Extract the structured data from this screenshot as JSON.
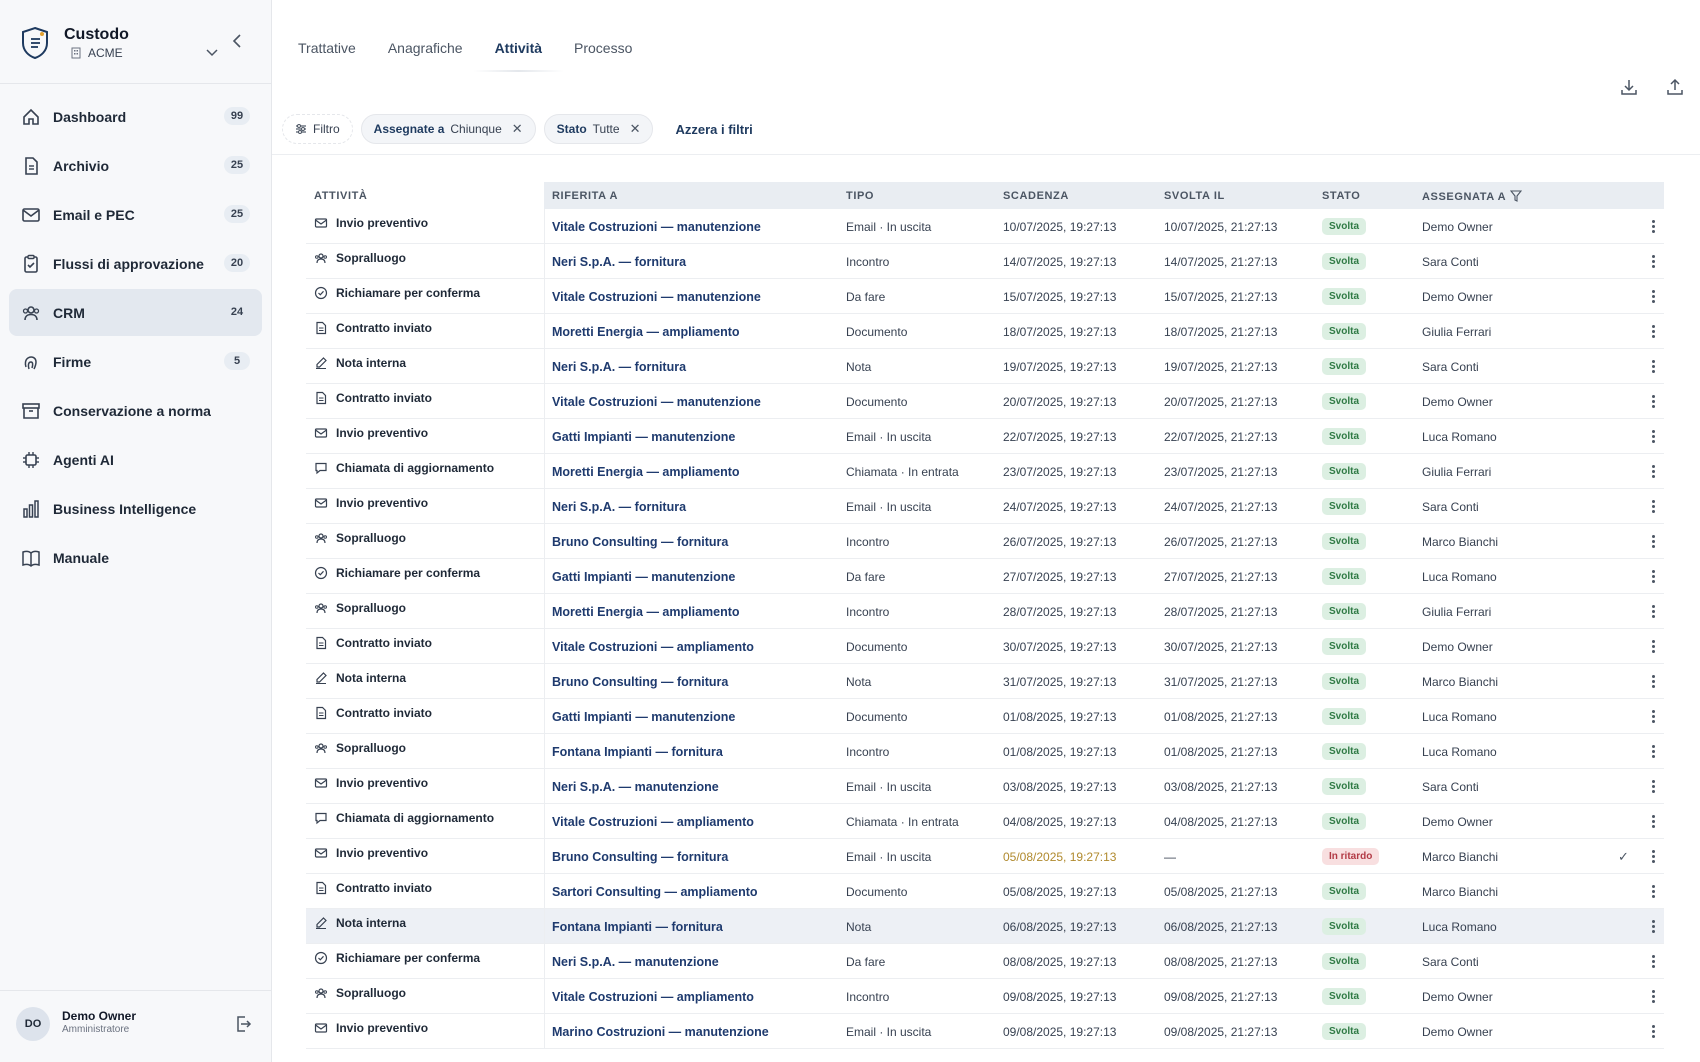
{
  "brand": {
    "name": "Custodo",
    "org": "ACME"
  },
  "nav": [
    {
      "label": "Dashboard",
      "badge": "99",
      "icon": "home-icon"
    },
    {
      "label": "Archivio",
      "badge": "25",
      "icon": "document-icon"
    },
    {
      "label": "Email e PEC",
      "badge": "25",
      "icon": "mail-icon"
    },
    {
      "label": "Flussi di approvazione",
      "badge": "20",
      "icon": "clipboard-check-icon"
    },
    {
      "label": "CRM",
      "badge": "24",
      "icon": "users-icon",
      "active": true
    },
    {
      "label": "Firme",
      "badge": "5",
      "icon": "fingerprint-icon"
    },
    {
      "label": "Conservazione a norma",
      "badge": "",
      "icon": "archive-box-icon"
    },
    {
      "label": "Agenti AI",
      "badge": "",
      "icon": "chip-icon"
    },
    {
      "label": "Business Intelligence",
      "badge": "",
      "icon": "bar-chart-icon"
    },
    {
      "label": "Manuale",
      "badge": "",
      "icon": "book-icon"
    }
  ],
  "user": {
    "initials": "DO",
    "name": "Demo Owner",
    "role": "Amministratore"
  },
  "tabs": [
    {
      "label": "Trattative",
      "active": false
    },
    {
      "label": "Anagrafiche",
      "active": false
    },
    {
      "label": "Attività",
      "active": true
    },
    {
      "label": "Processo",
      "active": false
    }
  ],
  "filters": {
    "filter_label": "Filtro",
    "chips": [
      {
        "key": "Assegnate a",
        "value": "Chiunque"
      },
      {
        "key": "Stato",
        "value": "Tutte"
      }
    ],
    "reset_label": "Azzera i filtri"
  },
  "table": {
    "headers": [
      "ATTIVITÀ",
      "RIFERITA A",
      "TIPO",
      "SCADENZA",
      "SVOLTA IL",
      "STATO",
      "ASSEGNATA A"
    ],
    "rows": [
      {
        "icon": "mail-icon",
        "attivita": "Invio preventivo",
        "riferita": "Vitale Costruzioni — manutenzione",
        "tipo": "Email · In uscita",
        "scadenza": "10/07/2025, 19:27:13",
        "svolta": "10/07/2025, 21:27:13",
        "stato": "Svolta",
        "assegnata": "Demo Owner"
      },
      {
        "icon": "people-icon",
        "attivita": "Sopralluogo",
        "riferita": "Neri S.p.A. — fornitura",
        "tipo": "Incontro",
        "scadenza": "14/07/2025, 19:27:13",
        "svolta": "14/07/2025, 21:27:13",
        "stato": "Svolta",
        "assegnata": "Sara Conti"
      },
      {
        "icon": "check-circle-icon",
        "attivita": "Richiamare per conferma",
        "riferita": "Vitale Costruzioni — manutenzione",
        "tipo": "Da fare",
        "scadenza": "15/07/2025, 19:27:13",
        "svolta": "15/07/2025, 21:27:13",
        "stato": "Svolta",
        "assegnata": "Demo Owner"
      },
      {
        "icon": "file-icon",
        "attivita": "Contratto inviato",
        "riferita": "Moretti Energia — ampliamento",
        "tipo": "Documento",
        "scadenza": "18/07/2025, 19:27:13",
        "svolta": "18/07/2025, 21:27:13",
        "stato": "Svolta",
        "assegnata": "Giulia Ferrari"
      },
      {
        "icon": "edit-icon",
        "attivita": "Nota interna",
        "riferita": "Neri S.p.A. — fornitura",
        "tipo": "Nota",
        "scadenza": "19/07/2025, 19:27:13",
        "svolta": "19/07/2025, 21:27:13",
        "stato": "Svolta",
        "assegnata": "Sara Conti"
      },
      {
        "icon": "file-icon",
        "attivita": "Contratto inviato",
        "riferita": "Vitale Costruzioni — manutenzione",
        "tipo": "Documento",
        "scadenza": "20/07/2025, 19:27:13",
        "svolta": "20/07/2025, 21:27:13",
        "stato": "Svolta",
        "assegnata": "Demo Owner"
      },
      {
        "icon": "mail-icon",
        "attivita": "Invio preventivo",
        "riferita": "Gatti Impianti — manutenzione",
        "tipo": "Email · In uscita",
        "scadenza": "22/07/2025, 19:27:13",
        "svolta": "22/07/2025, 21:27:13",
        "stato": "Svolta",
        "assegnata": "Luca Romano"
      },
      {
        "icon": "chat-icon",
        "attivita": "Chiamata di aggiornamento",
        "riferita": "Moretti Energia — ampliamento",
        "tipo": "Chiamata · In entrata",
        "scadenza": "23/07/2025, 19:27:13",
        "svolta": "23/07/2025, 21:27:13",
        "stato": "Svolta",
        "assegnata": "Giulia Ferrari"
      },
      {
        "icon": "mail-icon",
        "attivita": "Invio preventivo",
        "riferita": "Neri S.p.A. — fornitura",
        "tipo": "Email · In uscita",
        "scadenza": "24/07/2025, 19:27:13",
        "svolta": "24/07/2025, 21:27:13",
        "stato": "Svolta",
        "assegnata": "Sara Conti"
      },
      {
        "icon": "people-icon",
        "attivita": "Sopralluogo",
        "riferita": "Bruno Consulting — fornitura",
        "tipo": "Incontro",
        "scadenza": "26/07/2025, 19:27:13",
        "svolta": "26/07/2025, 21:27:13",
        "stato": "Svolta",
        "assegnata": "Marco Bianchi"
      },
      {
        "icon": "check-circle-icon",
        "attivita": "Richiamare per conferma",
        "riferita": "Gatti Impianti — manutenzione",
        "tipo": "Da fare",
        "scadenza": "27/07/2025, 19:27:13",
        "svolta": "27/07/2025, 21:27:13",
        "stato": "Svolta",
        "assegnata": "Luca Romano"
      },
      {
        "icon": "people-icon",
        "attivita": "Sopralluogo",
        "riferita": "Moretti Energia — ampliamento",
        "tipo": "Incontro",
        "scadenza": "28/07/2025, 19:27:13",
        "svolta": "28/07/2025, 21:27:13",
        "stato": "Svolta",
        "assegnata": "Giulia Ferrari"
      },
      {
        "icon": "file-icon",
        "attivita": "Contratto inviato",
        "riferita": "Vitale Costruzioni — ampliamento",
        "tipo": "Documento",
        "scadenza": "30/07/2025, 19:27:13",
        "svolta": "30/07/2025, 21:27:13",
        "stato": "Svolta",
        "assegnata": "Demo Owner"
      },
      {
        "icon": "edit-icon",
        "attivita": "Nota interna",
        "riferita": "Bruno Consulting — fornitura",
        "tipo": "Nota",
        "scadenza": "31/07/2025, 19:27:13",
        "svolta": "31/07/2025, 21:27:13",
        "stato": "Svolta",
        "assegnata": "Marco Bianchi"
      },
      {
        "icon": "file-icon",
        "attivita": "Contratto inviato",
        "riferita": "Gatti Impianti — manutenzione",
        "tipo": "Documento",
        "scadenza": "01/08/2025, 19:27:13",
        "svolta": "01/08/2025, 21:27:13",
        "stato": "Svolta",
        "assegnata": "Luca Romano"
      },
      {
        "icon": "people-icon",
        "attivita": "Sopralluogo",
        "riferita": "Fontana Impianti — fornitura",
        "tipo": "Incontro",
        "scadenza": "01/08/2025, 19:27:13",
        "svolta": "01/08/2025, 21:27:13",
        "stato": "Svolta",
        "assegnata": "Luca Romano"
      },
      {
        "icon": "mail-icon",
        "attivita": "Invio preventivo",
        "riferita": "Neri S.p.A. — manutenzione",
        "tipo": "Email · In uscita",
        "scadenza": "03/08/2025, 19:27:13",
        "svolta": "03/08/2025, 21:27:13",
        "stato": "Svolta",
        "assegnata": "Sara Conti"
      },
      {
        "icon": "chat-icon",
        "attivita": "Chiamata di aggiornamento",
        "riferita": "Vitale Costruzioni — ampliamento",
        "tipo": "Chiamata · In entrata",
        "scadenza": "04/08/2025, 19:27:13",
        "svolta": "04/08/2025, 21:27:13",
        "stato": "Svolta",
        "assegnata": "Demo Owner"
      },
      {
        "icon": "mail-icon",
        "attivita": "Invio preventivo",
        "riferita": "Bruno Consulting — fornitura",
        "tipo": "Email · In uscita",
        "scadenza": "05/08/2025, 19:27:13",
        "svolta": "—",
        "stato": "In ritardo",
        "assegnata": "Marco Bianchi",
        "late": true,
        "check": "✓"
      },
      {
        "icon": "file-icon",
        "attivita": "Contratto inviato",
        "riferita": "Sartori Consulting — ampliamento",
        "tipo": "Documento",
        "scadenza": "05/08/2025, 19:27:13",
        "svolta": "05/08/2025, 21:27:13",
        "stato": "Svolta",
        "assegnata": "Marco Bianchi"
      },
      {
        "icon": "edit-icon",
        "attivita": "Nota interna",
        "riferita": "Fontana Impianti — fornitura",
        "tipo": "Nota",
        "scadenza": "06/08/2025, 19:27:13",
        "svolta": "06/08/2025, 21:27:13",
        "stato": "Svolta",
        "assegnata": "Luca Romano",
        "highlight": true
      },
      {
        "icon": "check-circle-icon",
        "attivita": "Richiamare per conferma",
        "riferita": "Neri S.p.A. — manutenzione",
        "tipo": "Da fare",
        "scadenza": "08/08/2025, 19:27:13",
        "svolta": "08/08/2025, 21:27:13",
        "stato": "Svolta",
        "assegnata": "Sara Conti"
      },
      {
        "icon": "people-icon",
        "attivita": "Sopralluogo",
        "riferita": "Vitale Costruzioni — ampliamento",
        "tipo": "Incontro",
        "scadenza": "09/08/2025, 19:27:13",
        "svolta": "09/08/2025, 21:27:13",
        "stato": "Svolta",
        "assegnata": "Demo Owner"
      },
      {
        "icon": "mail-icon",
        "attivita": "Invio preventivo",
        "riferita": "Marino Costruzioni — manutenzione",
        "tipo": "Email · In uscita",
        "scadenza": "09/08/2025, 19:27:13",
        "svolta": "09/08/2025, 21:27:13",
        "stato": "Svolta",
        "assegnata": "Demo Owner"
      }
    ]
  },
  "colors": {
    "accent": "#1e3a5f",
    "ok_bg": "#dcefe2",
    "ok_fg": "#2f7a44",
    "late_bg": "#f8dfe0",
    "late_fg": "#b23a45",
    "late_date": "#b08a2e"
  }
}
